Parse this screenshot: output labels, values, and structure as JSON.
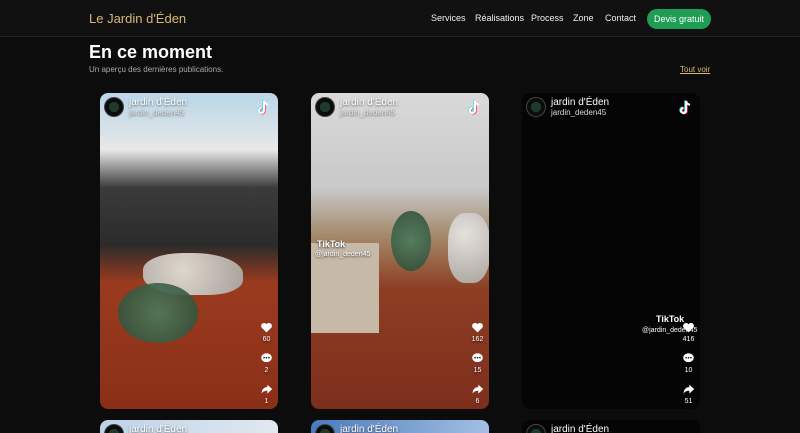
{
  "brand": "Le Jardin d'Éden",
  "nav": [
    "Services",
    "Réalisations",
    "Process",
    "Zone",
    "Contact"
  ],
  "cta_label": "Devis gratuit",
  "section": {
    "title": "En ce moment",
    "subtitle": "Un aperçu des dernières publications.",
    "see_all": "Tout voir"
  },
  "cards": [
    {
      "account": "jardin d'Éden",
      "handle": "jardin_deden45",
      "likes": "60",
      "comments": "2",
      "shares": "1",
      "watermark": "",
      "wm_handle": ""
    },
    {
      "account": "jardin d'Éden",
      "handle": "jardin_deden45",
      "likes": "162",
      "comments": "15",
      "shares": "6",
      "watermark": "TikTok",
      "wm_handle": "@jardin_deden45"
    },
    {
      "account": "jardin d'Éden",
      "handle": "jardin_deden45",
      "likes": "416",
      "comments": "10",
      "shares": "51",
      "watermark": "TikTok",
      "wm_handle": "@jardin_deden45"
    }
  ],
  "row2": [
    {
      "account": "jardin d'Éden"
    },
    {
      "account": "jardin d'Éden"
    },
    {
      "account": "jardin d'Éden"
    }
  ],
  "colors": {
    "brand": "#d9b776",
    "cta": "#1f9d55",
    "background": "#0c0c0c"
  },
  "icons": {
    "platform": "tiktok-icon",
    "like": "heart-icon",
    "comment": "comment-icon",
    "share": "share-icon"
  }
}
